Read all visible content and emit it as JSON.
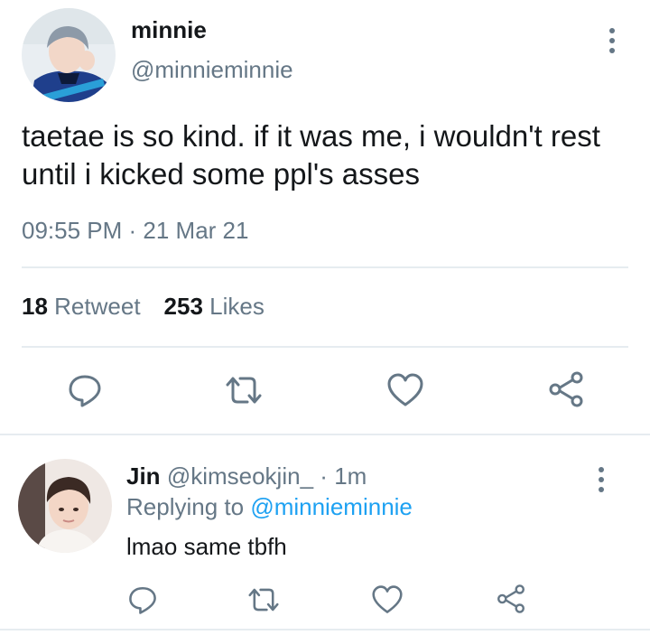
{
  "main_tweet": {
    "display_name": "minnie",
    "handle": "@minnieminnie",
    "text": "taetae is so kind. if it was me, i wouldn't rest until i kicked some ppl's asses",
    "timestamp": "09:55 PM · 21 Mar 21",
    "retweet_count": "18",
    "retweet_label": "Retweet",
    "like_count": "253",
    "like_label": "Likes"
  },
  "reply": {
    "display_name": "Jin",
    "handle": "@kimseokjin_",
    "separator": "·",
    "time_ago": "1m",
    "replying_to_label": "Replying to",
    "replying_to_handle": "@minnieminnie",
    "text": "lmao same tbfh"
  },
  "icons": {
    "options": "kebab-vertical-icon",
    "reply": "speech-bubble-icon",
    "retweet": "retweet-arrows-icon",
    "like": "heart-icon",
    "share": "share-nodes-icon"
  },
  "colors": {
    "text_primary": "#14171a",
    "text_secondary": "#657786",
    "link": "#1da1f2",
    "divider": "#e6ecf0",
    "background": "#ffffff"
  }
}
